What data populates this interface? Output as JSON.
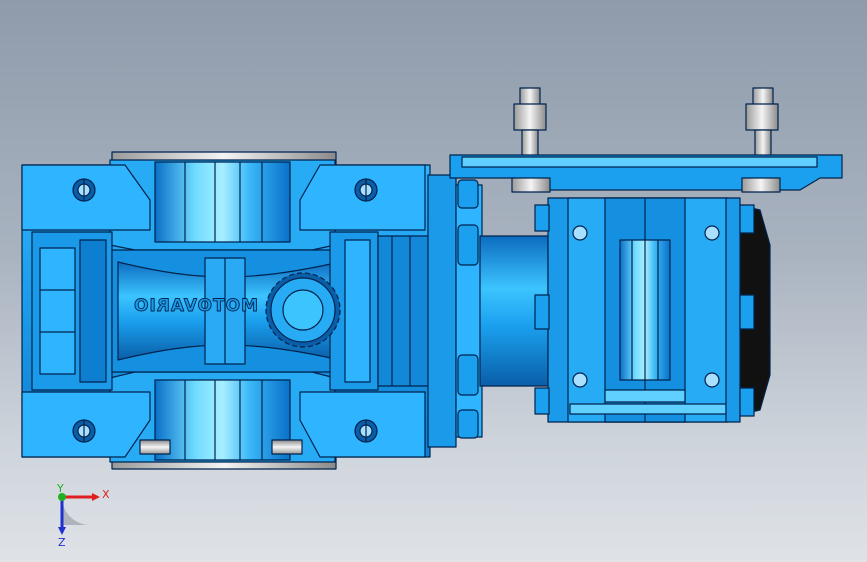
{
  "viewport": {
    "background_top": "#8f9bab",
    "background_bottom": "#dfe3e8"
  },
  "model": {
    "brand_text": "MOTOVARIO",
    "body_color": "#1aa0ee",
    "highlight_color": "#5fd0ff",
    "dark_color": "#0a5ea8",
    "edge_color": "#00234d",
    "seal_color": "#111111",
    "steel_color": "#d8d8d8"
  },
  "triad": {
    "x_label": "X",
    "y_label": "Y",
    "z_label": "Z",
    "x_color": "#e02020",
    "y_color": "#20b020",
    "z_color": "#2030d0"
  }
}
